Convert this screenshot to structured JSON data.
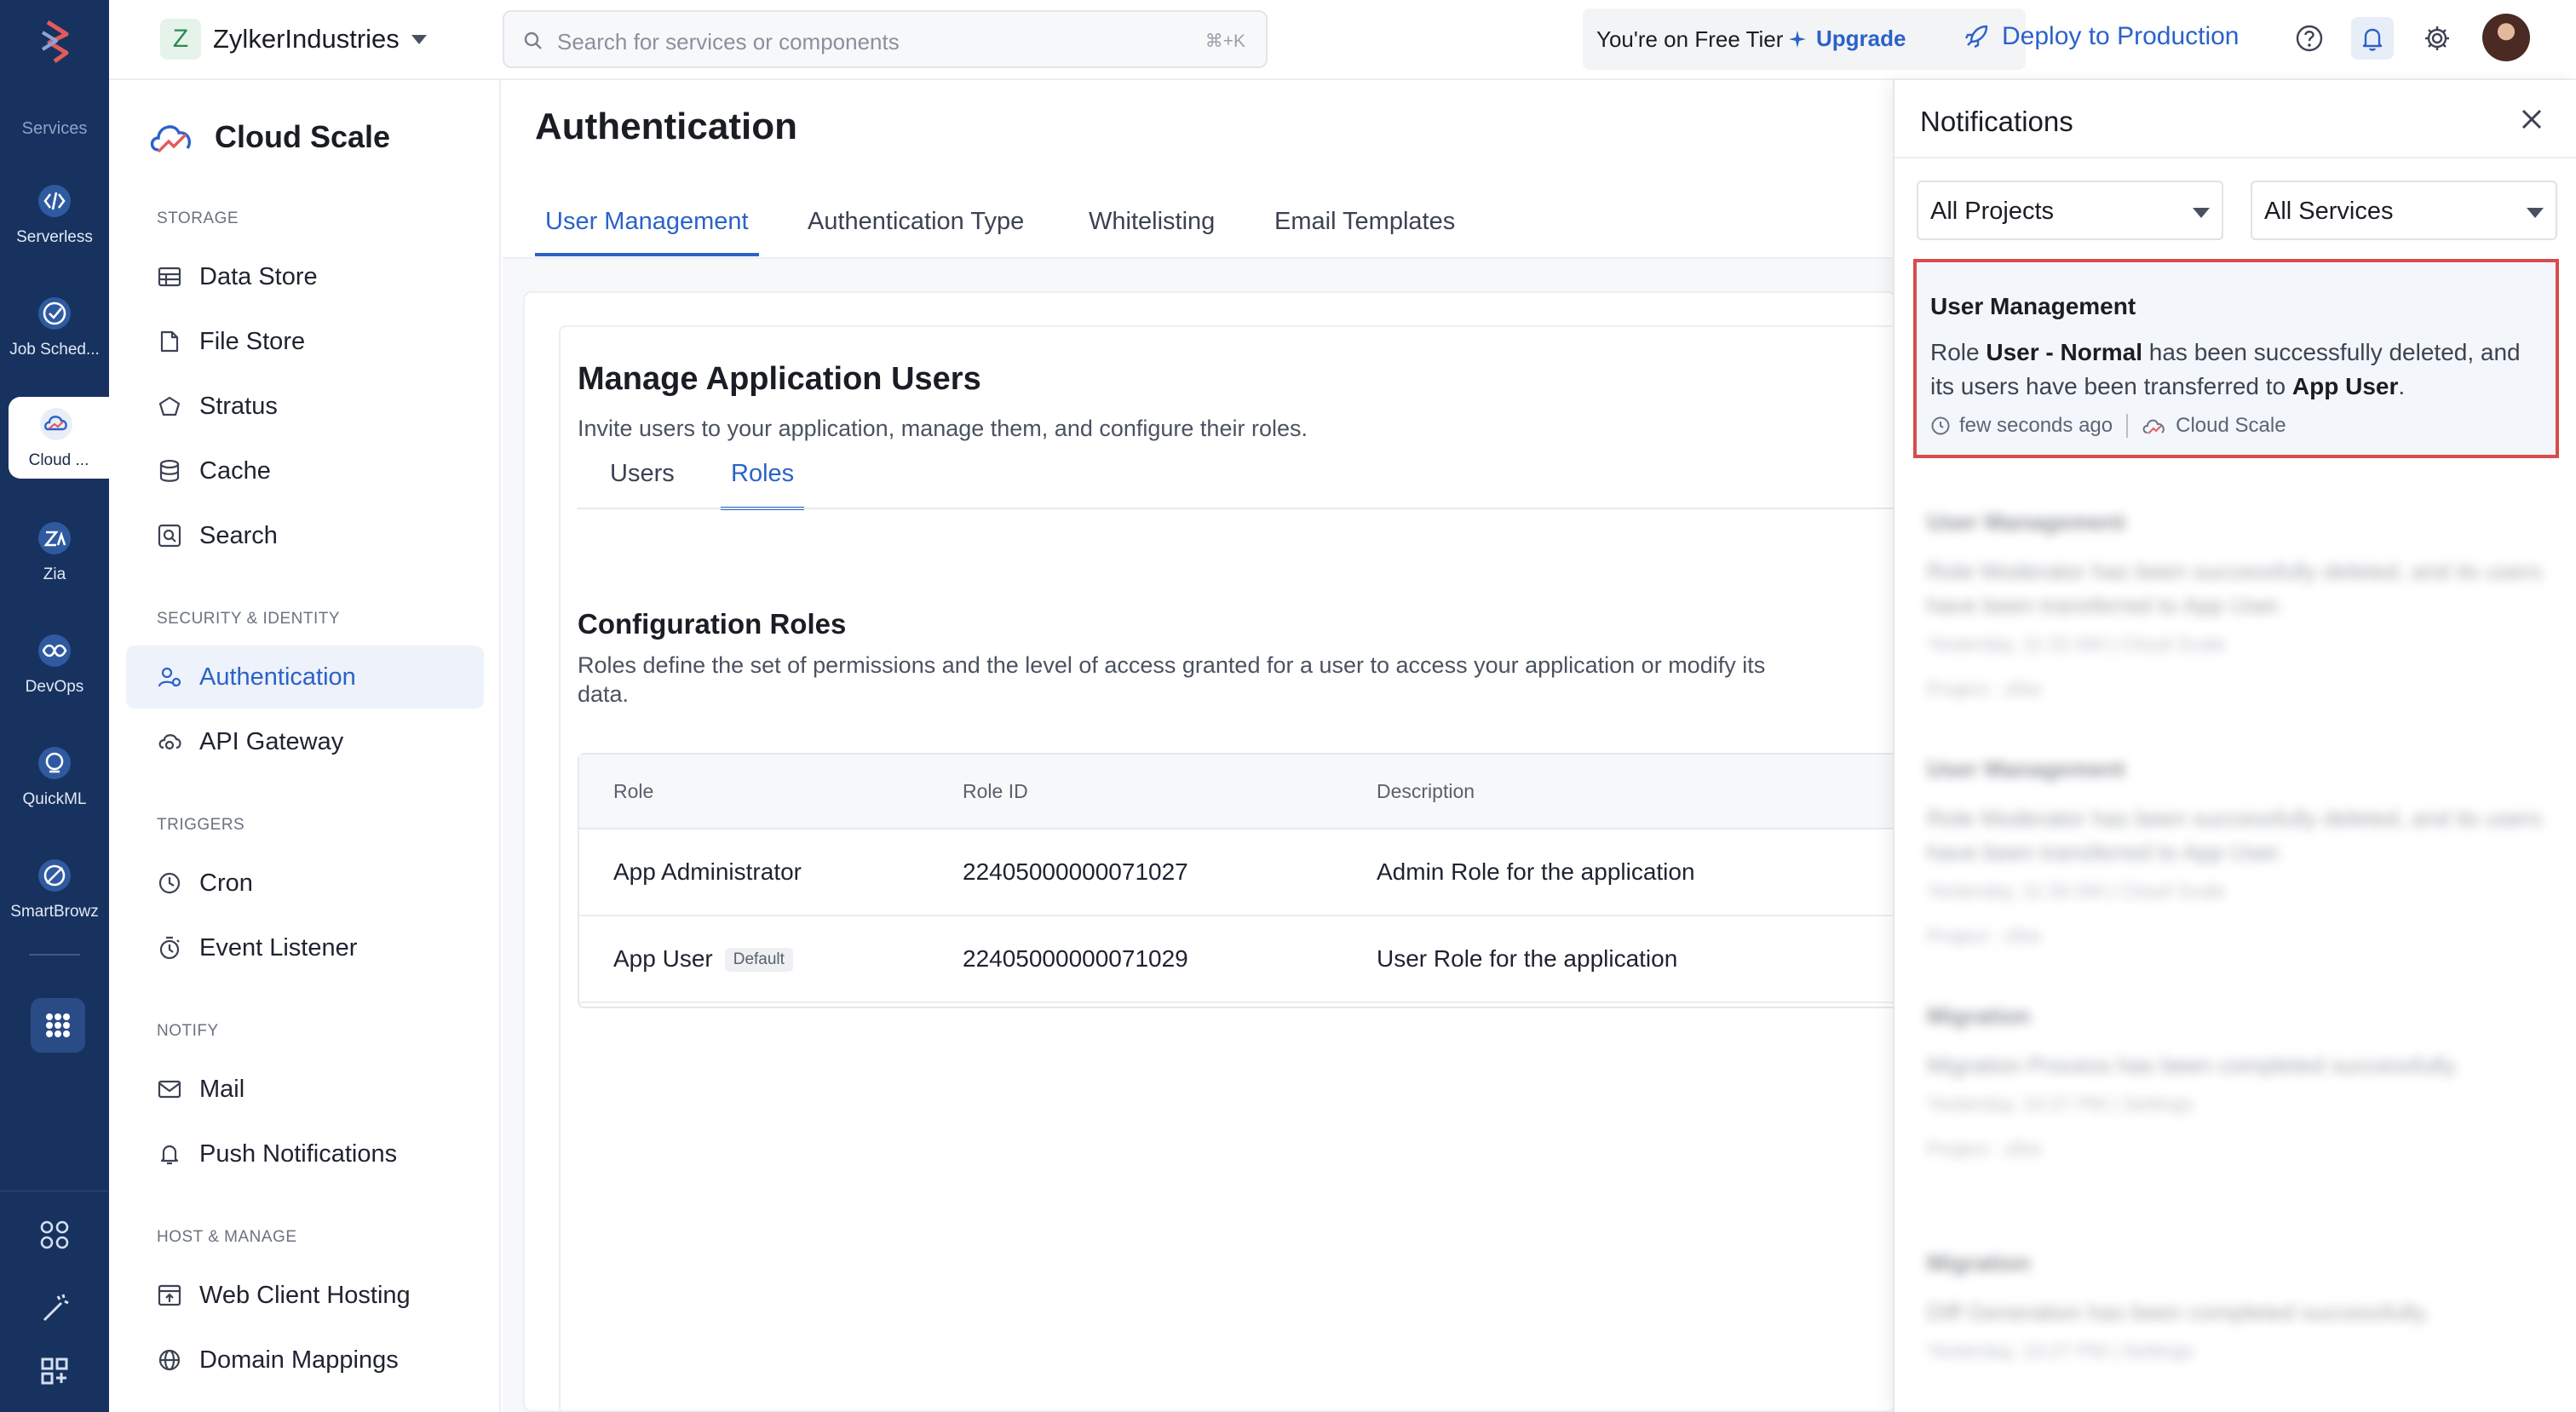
{
  "rail": {
    "section_label": "Services",
    "items": [
      {
        "label": "Serverless",
        "icon": "serverless-icon"
      },
      {
        "label": "Job Sched...",
        "icon": "job-scheduling-icon"
      },
      {
        "label": "Cloud ...",
        "icon": "cloud-scale-icon",
        "active": true
      },
      {
        "label": "Zia",
        "icon": "zia-icon"
      },
      {
        "label": "DevOps",
        "icon": "devops-icon"
      },
      {
        "label": "QuickML",
        "icon": "quickml-icon"
      },
      {
        "label": "SmartBrowz",
        "icon": "smartbrowz-icon"
      }
    ]
  },
  "topbar": {
    "org_initial": "Z",
    "org_name": "ZylkerIndustries",
    "search_placeholder": "Search for services or components",
    "search_shortcut": "⌘+K",
    "tier_text": "You're on Free Tier",
    "upgrade_label": "Upgrade",
    "deploy_label": "Deploy to Production"
  },
  "service_sidebar": {
    "title": "Cloud Scale",
    "categories": {
      "storage": "STORAGE",
      "security": "SECURITY & IDENTITY",
      "triggers": "TRIGGERS",
      "notify": "NOTIFY",
      "host": "HOST & MANAGE"
    },
    "items": {
      "data_store": "Data Store",
      "file_store": "File Store",
      "stratus": "Stratus",
      "cache": "Cache",
      "search": "Search",
      "authentication": "Authentication",
      "api_gateway": "API Gateway",
      "cron": "Cron",
      "event_listener": "Event Listener",
      "mail": "Mail",
      "push_notifications": "Push Notifications",
      "web_client_hosting": "Web Client Hosting",
      "domain_mappings": "Domain Mappings"
    }
  },
  "main": {
    "title": "Authentication",
    "tabs": [
      "User Management",
      "Authentication Type",
      "Whitelisting",
      "Email Templates"
    ],
    "heading": "Manage Application Users",
    "subheading": "Invite users to your application, manage them, and configure their roles.",
    "subtabs": [
      "Users",
      "Roles"
    ],
    "roles_heading": "Configuration Roles",
    "roles_description": "Roles define the set of permissions and the level of access granted for a user to access your application or modify its data.",
    "table": {
      "columns": [
        "Role",
        "Role ID",
        "Description"
      ],
      "rows": [
        {
          "role": "App Administrator",
          "badge": "",
          "role_id": "22405000000071027",
          "description": "Admin Role for the application"
        },
        {
          "role": "App User",
          "badge": "Default",
          "role_id": "22405000000071029",
          "description": "User Role for the application"
        }
      ]
    }
  },
  "notifications": {
    "title": "Notifications",
    "project_filter": "All Projects",
    "service_filter": "All Services",
    "highlighted": {
      "title": "User Management",
      "body_prefix": "Role ",
      "body_role": "User - Normal",
      "body_middle": " has been successfully deleted, and its users have been transferred to ",
      "body_target": "App User",
      "body_suffix": ".",
      "time": "few seconds ago",
      "service": "Cloud Scale"
    },
    "blurred": [
      {
        "title": "User Management",
        "body": "Role Moderator has been successfully deleted, and its users have been transferred to App User.",
        "meta": "Yesterday, 11:32 AM  |  Cloud Scale",
        "project": "Project : zfire"
      },
      {
        "title": "User Management",
        "body": "Role Moderator has been successfully deleted, and its users have been transferred to App User.",
        "meta": "Yesterday, 11:30 AM  |  Cloud Scale",
        "project": "Project : zfire"
      },
      {
        "title": "Migration",
        "body": "Migration Process has been completed successfully.",
        "meta": "Yesterday, 10:27 PM  |  Settings",
        "project": "Project : zfire"
      },
      {
        "title": "Migration",
        "body": "Diff Generation has been completed successfully.",
        "meta": "Yesterday, 10:27 PM  |  Settings",
        "project": ""
      }
    ]
  }
}
